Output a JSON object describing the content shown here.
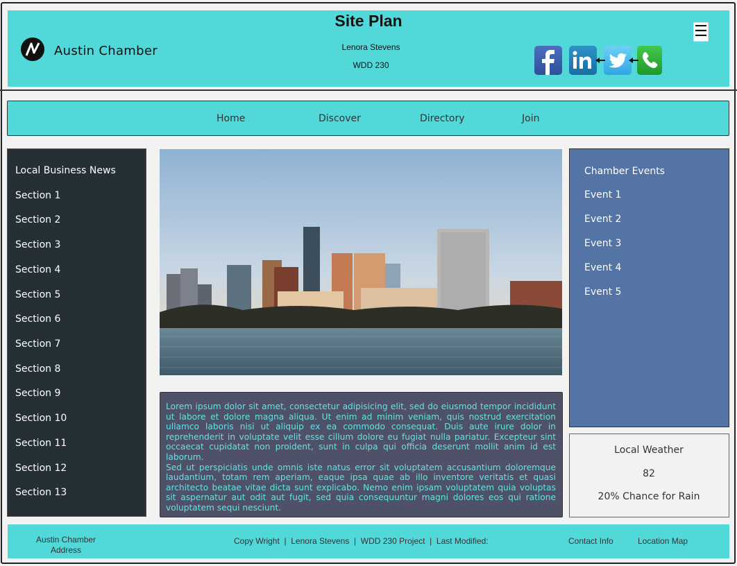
{
  "header": {
    "brand": "Austin Chamber",
    "title": "Site Plan",
    "author": "Lenora Stevens",
    "course": "WDD 230",
    "menu_icon": "☰",
    "social": [
      "facebook-icon",
      "linkedin-icon",
      "twitter-icon",
      "phone-icon"
    ]
  },
  "nav": {
    "items": [
      "Home",
      "Discover",
      "Directory",
      "Join"
    ]
  },
  "left_sidebar": {
    "heading": "Local Business News",
    "items": [
      "Section 1",
      "Section 2",
      "Section 3",
      "Section 4",
      "Section 5",
      "Section 6",
      "Section 7",
      "Section 8",
      "Section 9",
      "Section 10",
      "Section 11",
      "Section 12",
      "Section 13"
    ]
  },
  "main": {
    "paragraph1": "Lorem ipsum dolor sit amet, consectetur adipisicing elit, sed do eiusmod tempor incididunt ut labore et dolore magna aliqua. Ut enim ad minim veniam, quis nostrud exercitation ullamco laboris nisi ut aliquip ex ea commodo consequat. Duis aute irure dolor in reprehenderit in voluptate velit esse cillum dolore eu fugiat nulla pariatur. Excepteur sint occaecat cupidatat non proident, sunt in culpa qui officia deserunt mollit anim id est laborum.",
    "paragraph2": "Sed ut perspiciatis unde omnis iste natus error sit voluptatem accusantium doloremque laudantium, totam rem aperiam, eaque ipsa quae ab illo inventore veritatis et quasi architecto beatae vitae dicta sunt explicabo. Nemo enim ipsam voluptatem quia voluptas sit aspernatur aut odit aut fugit, sed quia consequuntur magni dolores eos qui ratione voluptatem sequi nesciunt."
  },
  "right_sidebar": {
    "heading": "Chamber Events",
    "items": [
      "Event 1",
      "Event 2",
      "Event 3",
      "Event 4",
      "Event 5"
    ]
  },
  "weather": {
    "title": "Local Weather",
    "temperature": "82",
    "forecast": "20% Chance for Rain"
  },
  "footer": {
    "org_name": "Austin Chamber",
    "address": "Address",
    "copyright": "Copy Wright  |  Lenora Stevens  |  WDD 230 Project  |  Last Modified:",
    "contact": "Contact Info",
    "map": "Location Map"
  },
  "colors": {
    "accent": "#53d8d9",
    "left_sidebar": "#253036",
    "right_sidebar": "#5374a4",
    "text_box": "#4e5168"
  }
}
